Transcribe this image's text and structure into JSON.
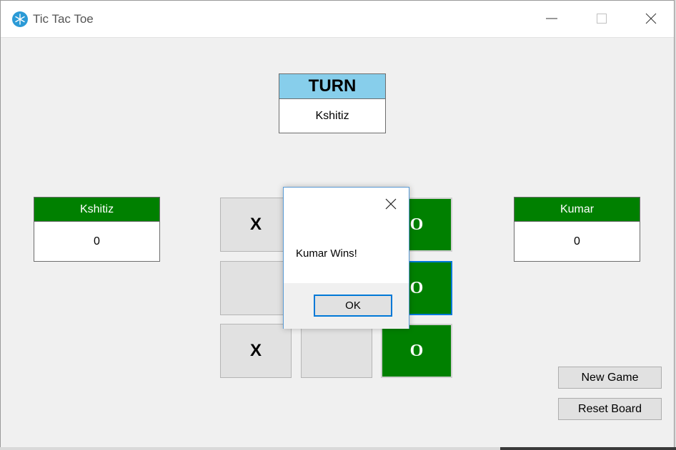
{
  "window": {
    "title": "Tic Tac Toe",
    "icon": "snowflake-icon"
  },
  "turn": {
    "heading": "TURN",
    "player": "Kshitiz"
  },
  "players": [
    {
      "name": "Kshitiz",
      "score": "0"
    },
    {
      "name": "Kumar",
      "score": "0"
    }
  ],
  "board": {
    "cells": [
      "X",
      "",
      "O",
      "",
      "",
      "O",
      "X",
      "",
      "O"
    ]
  },
  "buttons": {
    "new_game": "New Game",
    "reset_board": "Reset Board"
  },
  "dialog": {
    "message": "Kumar Wins!",
    "ok": "OK"
  },
  "colors": {
    "turn_header": "#87ceeb",
    "player_header": "#008000",
    "winning_cell": "#008000",
    "focus": "#0078d7"
  }
}
